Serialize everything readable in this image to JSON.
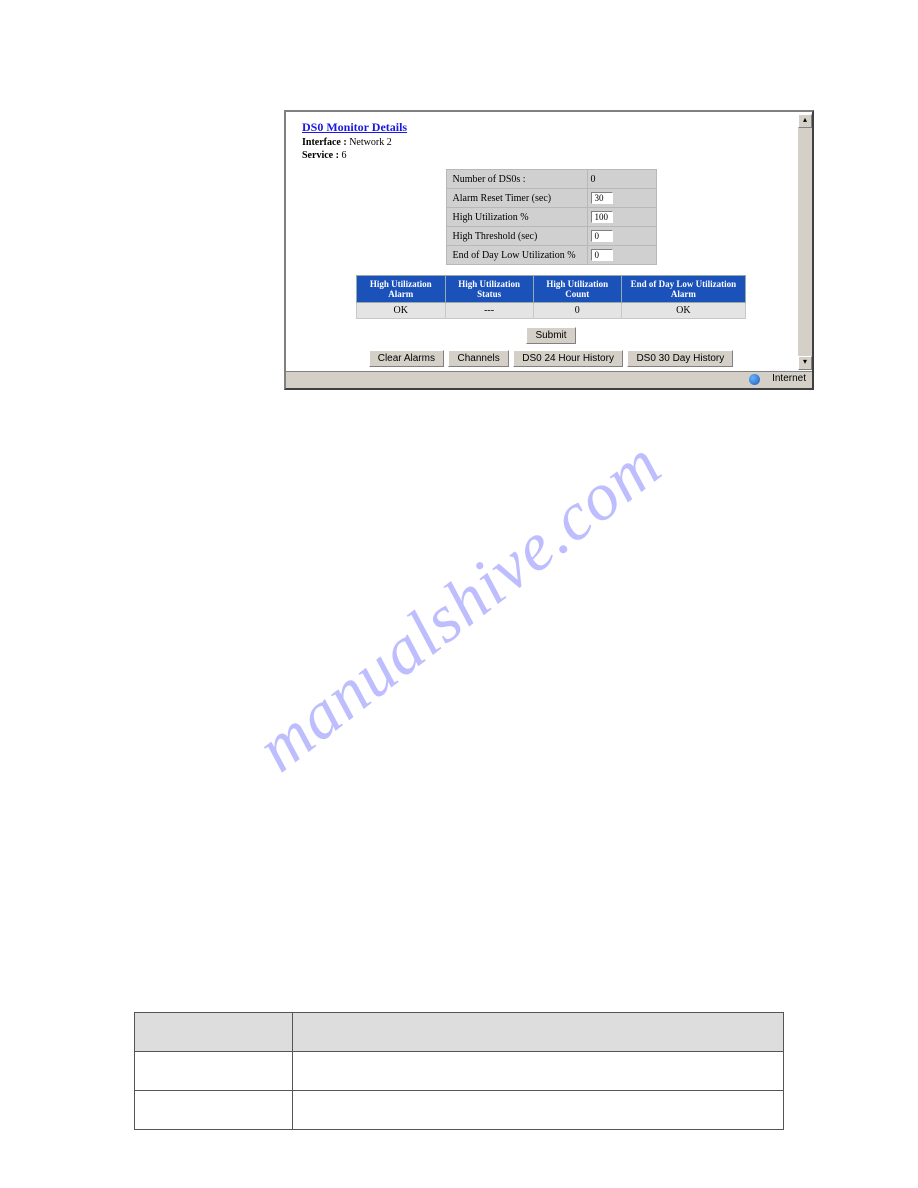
{
  "screenshot": {
    "title_link": "DS0 Monitor Details",
    "interface_label": "Interface :",
    "interface_value": "Network 2",
    "service_label": "Service :",
    "service_value": "6",
    "params": [
      {
        "label": "Number of DS0s :",
        "value": "0",
        "readonly": true
      },
      {
        "label": "Alarm Reset Timer (sec)",
        "value": "30",
        "readonly": false
      },
      {
        "label": "High Utilization %",
        "value": "100",
        "readonly": false
      },
      {
        "label": "High Threshold (sec)",
        "value": "0",
        "readonly": false
      },
      {
        "label": "End of Day Low Utilization %",
        "value": "0",
        "readonly": false
      }
    ],
    "status_headers": [
      "High Utilization Alarm",
      "High Utilization Status",
      "High Utilization Count",
      "End of Day Low Utilization Alarm"
    ],
    "status_row": [
      "OK",
      "---",
      "0",
      "OK"
    ],
    "buttons": {
      "submit": "Submit",
      "clear_alarms": "Clear Alarms",
      "channels": "Channels",
      "history24": "DS0 24 Hour History",
      "history30": "DS0 30 Day History"
    },
    "statusbar_zone": "Internet"
  },
  "watermark": "manualshive.com"
}
